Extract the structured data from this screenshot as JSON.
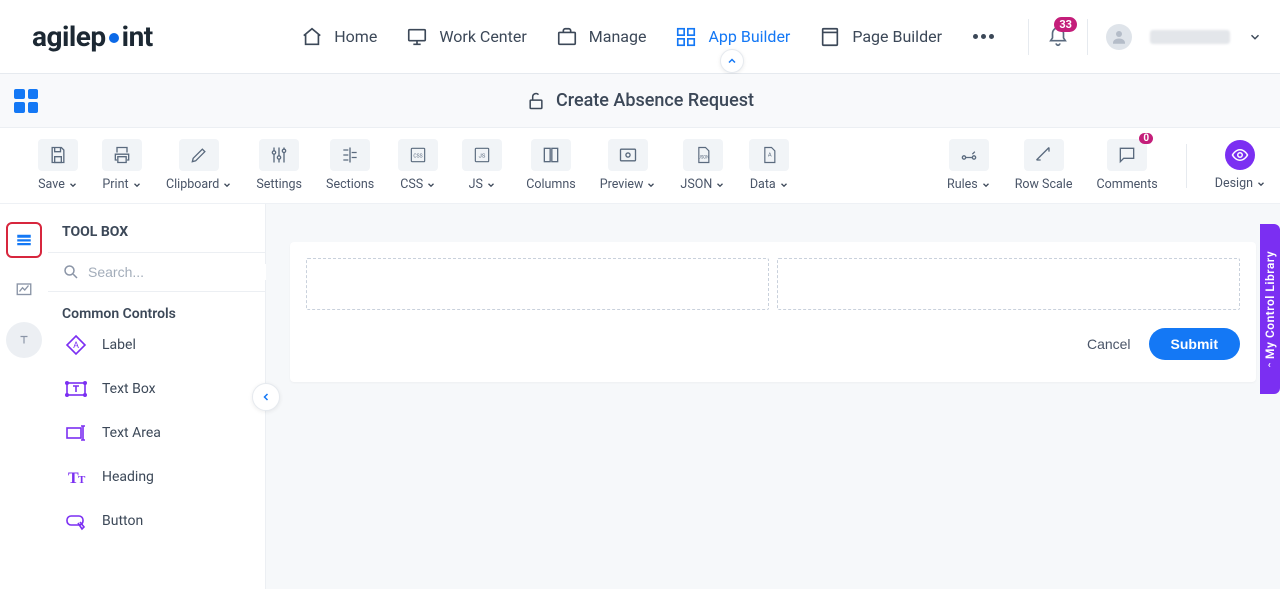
{
  "brand": {
    "text_a": "agilep",
    "text_b": "int"
  },
  "nav": {
    "home": "Home",
    "work_center": "Work Center",
    "manage": "Manage",
    "app_builder": "App Builder",
    "page_builder": "Page Builder"
  },
  "notifications": {
    "count": "33"
  },
  "title_bar": {
    "form_title": "Create Absence Request"
  },
  "toolbar": {
    "save": "Save",
    "print": "Print",
    "clipboard": "Clipboard",
    "settings": "Settings",
    "sections": "Sections",
    "css": "CSS",
    "js": "JS",
    "columns": "Columns",
    "preview": "Preview",
    "json": "JSON",
    "data": "Data",
    "rules": "Rules",
    "row_scale": "Row Scale",
    "comments": "Comments",
    "comments_count": "0",
    "design": "Design"
  },
  "toolbox": {
    "title": "TOOL BOX",
    "search_placeholder": "Search...",
    "common_section": "Common Controls",
    "items": {
      "label": "Label",
      "textbox": "Text Box",
      "textarea": "Text Area",
      "heading": "Heading",
      "button": "Button"
    }
  },
  "canvas": {
    "cancel": "Cancel",
    "submit": "Submit"
  },
  "side_flag": "My Control Library"
}
